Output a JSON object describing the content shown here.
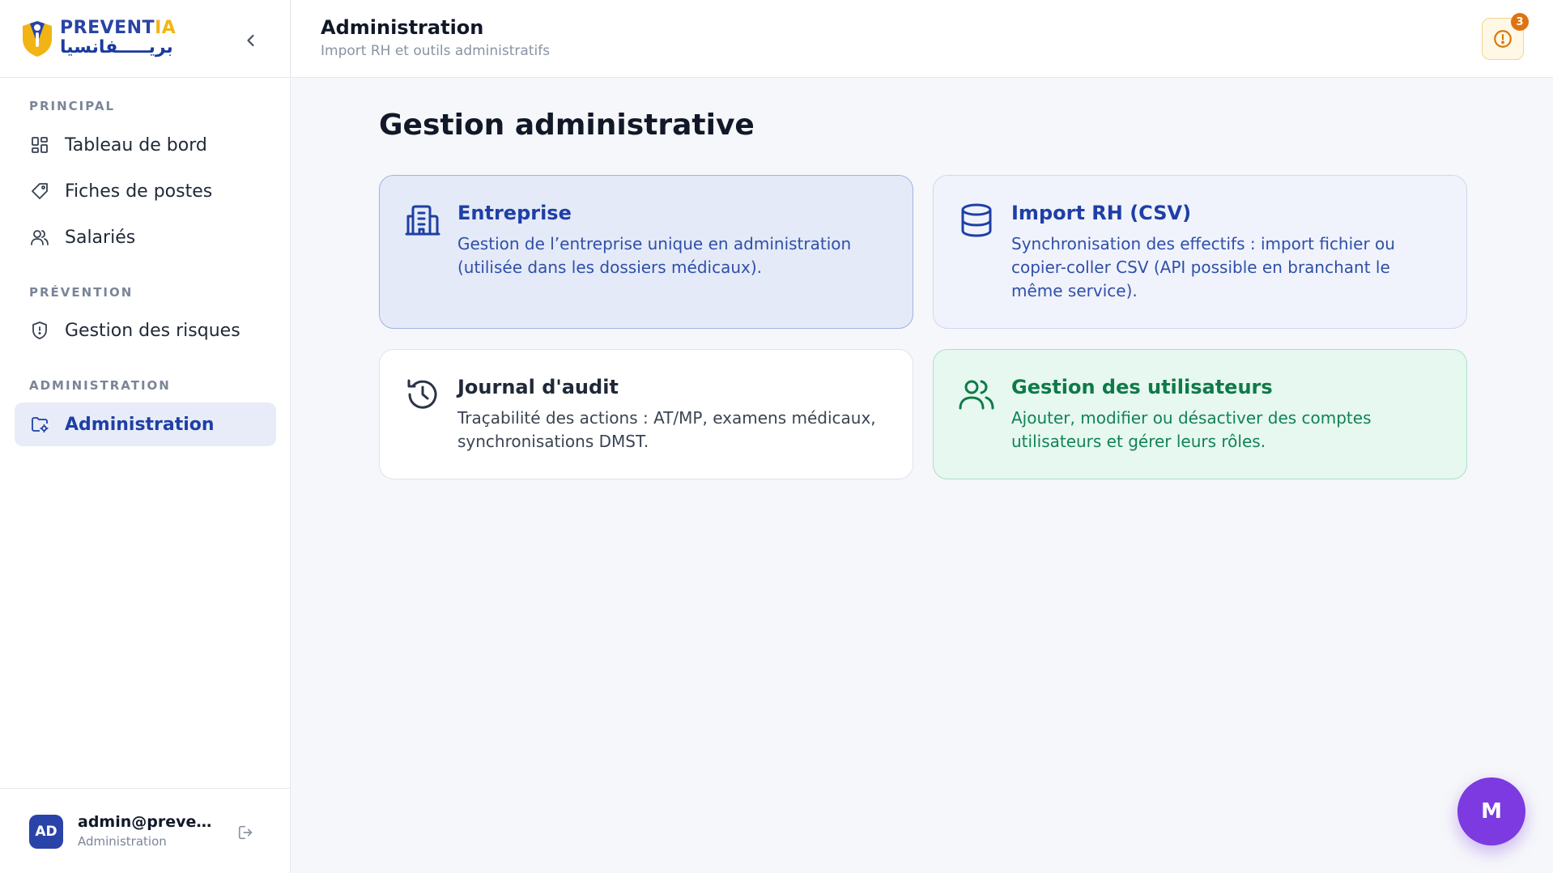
{
  "brand": {
    "name_main": "PREVENT",
    "name_accent": "IA",
    "name_arabic": "بريـــــفانسيا",
    "colors": {
      "primary": "#2943a6",
      "accent": "#f2b414"
    }
  },
  "sidebar": {
    "sections": [
      {
        "label": "PRINCIPAL"
      },
      {
        "label": "PRÉVENTION"
      },
      {
        "label": "ADMINISTRATION"
      }
    ],
    "items": [
      {
        "label": "Tableau de bord",
        "icon": "dashboard-icon"
      },
      {
        "label": "Fiches de postes",
        "icon": "tag-icon"
      },
      {
        "label": "Salariés",
        "icon": "users-icon"
      },
      {
        "label": "Gestion des risques",
        "icon": "shield-icon"
      },
      {
        "label": "Administration",
        "icon": "folder-settings-icon",
        "active": true
      }
    ]
  },
  "user": {
    "initials": "AD",
    "email": "admin@preventia.local",
    "role": "Administration"
  },
  "header": {
    "title": "Administration",
    "subtitle": "Import RH et outils administratifs",
    "alert_count": "3"
  },
  "main": {
    "title": "Gestion administrative",
    "cards": [
      {
        "title": "Entreprise",
        "description": "Gestion de l’entreprise unique en administration (utilisée dans les dossiers médicaux).",
        "icon": "building-icon"
      },
      {
        "title": "Import RH (CSV)",
        "description": "Synchronisation des effectifs : import fichier ou copier-coller CSV (API possible en branchant le même service).",
        "icon": "database-icon"
      },
      {
        "title": "Journal d'audit",
        "description": "Traçabilité des actions : AT/MP, examens médicaux, synchronisations DMST.",
        "icon": "history-icon"
      },
      {
        "title": "Gestion des utilisateurs",
        "description": "Ajouter, modifier ou désactiver des comptes utilisateurs et gérer leurs rôles.",
        "icon": "users-icon"
      }
    ]
  },
  "fab": {
    "label": "M",
    "color": "#7c3ae0"
  }
}
